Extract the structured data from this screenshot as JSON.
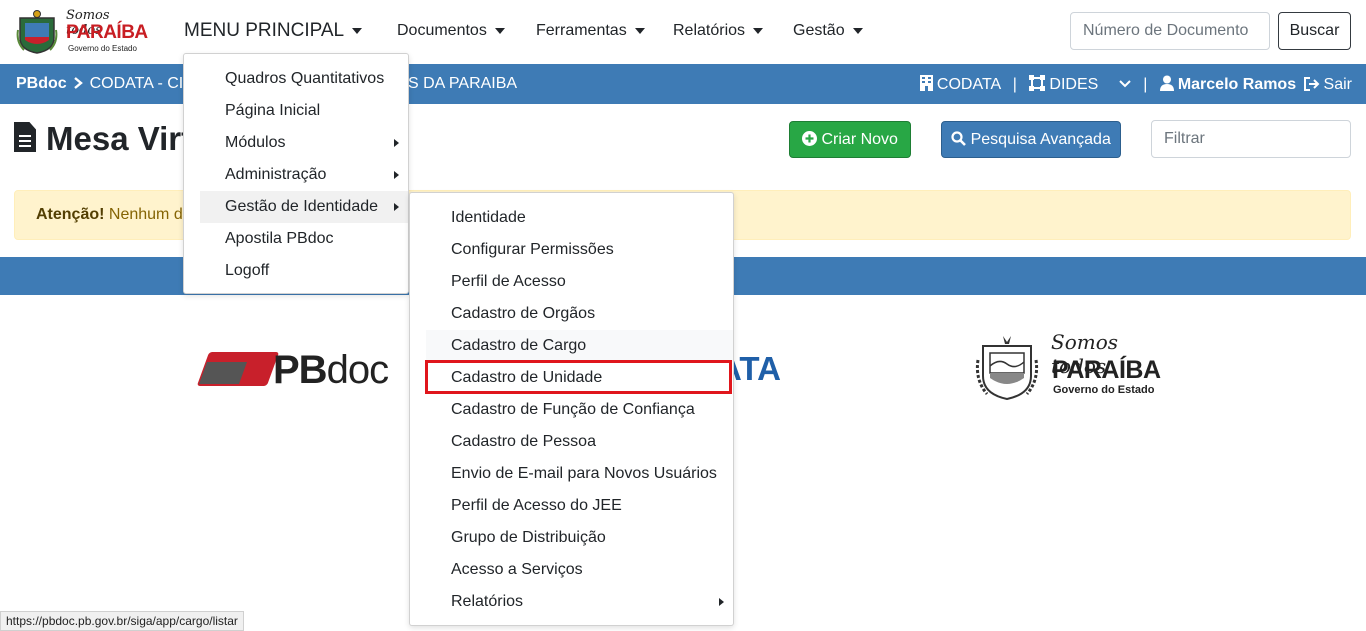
{
  "header": {
    "logo": {
      "line1": "Somos todos",
      "line2": "PARAÍBA",
      "line3": "Governo do Estado"
    },
    "main_menu_label": "MENU PRINCIPAL",
    "nav": [
      "Documentos",
      "Ferramentas",
      "Relatórios",
      "Gestão"
    ],
    "doc_number_placeholder": "Número de Documento",
    "search_button": "Buscar"
  },
  "breadcrumb": {
    "app": "PBdoc",
    "org": "CODATA - CIA",
    "org_rest": "S DA PARAIBA",
    "unit1": "CODATA",
    "unit2": "DIDES",
    "user": "Marcelo Ramos",
    "logout": "Sair"
  },
  "page": {
    "title": "Mesa Virt",
    "create_button": "Criar Novo",
    "advanced_search_button": "Pesquisa Avançada",
    "filter_placeholder": "Filtrar",
    "alert_bold": "Atenção!",
    "alert_text": "Nenhum do"
  },
  "logos": {
    "pbdoc_bold": "PB",
    "pbdoc_rest": "doc",
    "codata": "ATA",
    "gov_line1": "Somos todos",
    "gov_line2": "PARAÍBA",
    "gov_line3": "Governo do Estado"
  },
  "main_menu": {
    "items": [
      {
        "label": "Quadros Quantitativos",
        "submenu": false
      },
      {
        "label": "Página Inicial",
        "submenu": false
      },
      {
        "label": "Módulos",
        "submenu": true
      },
      {
        "label": "Administração",
        "submenu": true
      },
      {
        "label": "Gestão de Identidade",
        "submenu": true,
        "active": true
      },
      {
        "label": "Apostila PBdoc",
        "submenu": false
      },
      {
        "label": "Logoff",
        "submenu": false
      }
    ]
  },
  "identity_menu": {
    "items": [
      {
        "label": "Identidade"
      },
      {
        "label": "Configurar Permissões"
      },
      {
        "label": "Perfil de Acesso"
      },
      {
        "label": "Cadastro de Orgãos"
      },
      {
        "label": "Cadastro de Cargo",
        "hover": true
      },
      {
        "label": "Cadastro de Unidade",
        "highlighted": true
      },
      {
        "label": "Cadastro de Função de Confiança"
      },
      {
        "label": "Cadastro de Pessoa"
      },
      {
        "label": "Envio de E-mail para Novos Usuários"
      },
      {
        "label": "Perfil de Acesso do JEE"
      },
      {
        "label": "Grupo de Distribuição"
      },
      {
        "label": "Acesso a Serviços"
      },
      {
        "label": "Relatórios",
        "submenu": true
      }
    ]
  },
  "status_url": "https://pbdoc.pb.gov.br/siga/app/cargo/listar",
  "colors": {
    "primary": "#3e7bb5",
    "success": "#28a745",
    "highlight": "#e0161c",
    "brand_red": "#c8202b"
  }
}
